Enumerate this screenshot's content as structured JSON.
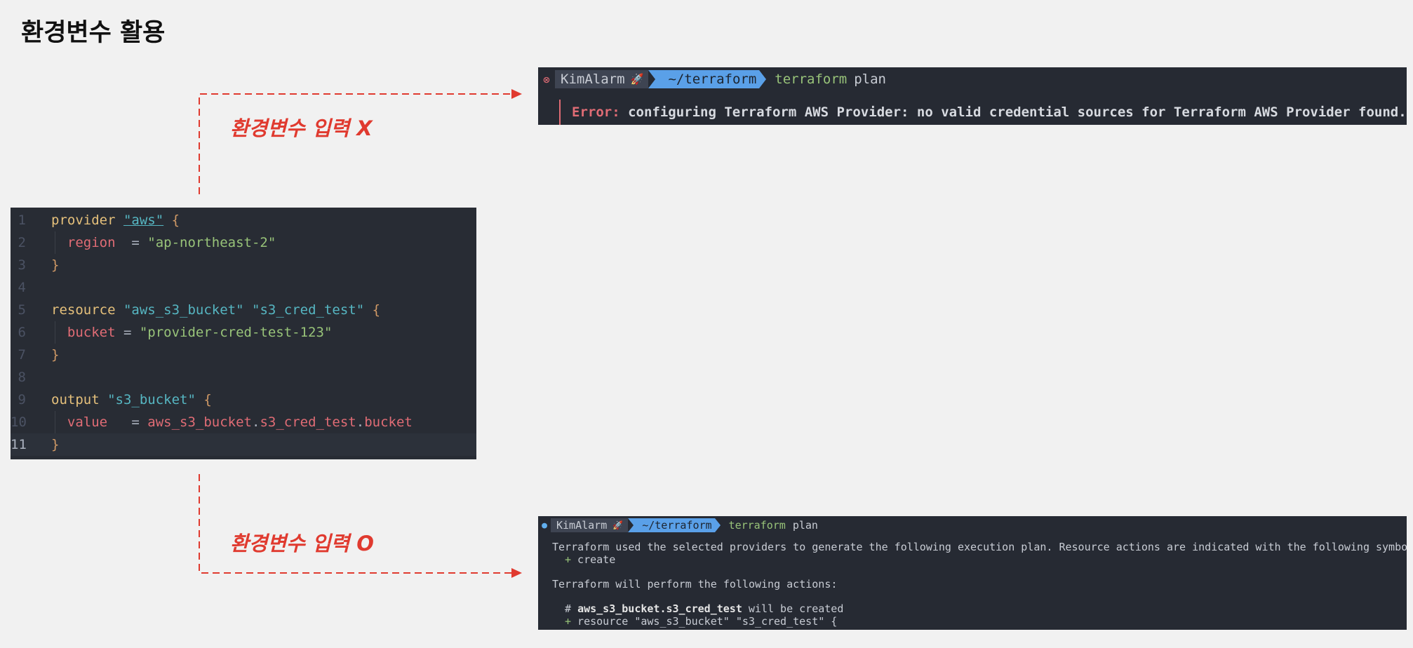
{
  "title": "환경변수 활용",
  "editor": {
    "lines": [
      {
        "n": "1",
        "parts": [
          {
            "t": "provider",
            "c": "tk-kw"
          },
          {
            "t": " ",
            "c": ""
          },
          {
            "t": "\"aws\"",
            "c": "tk-lbl tk-underline"
          },
          {
            "t": " {",
            "c": "tk-brace"
          }
        ]
      },
      {
        "n": "2",
        "parts": [
          {
            "t": "  region",
            "c": "tk-attr"
          },
          {
            "t": "  = ",
            "c": "tk-op"
          },
          {
            "t": "\"ap-northeast-2\"",
            "c": "tk-str"
          }
        ]
      },
      {
        "n": "3",
        "parts": [
          {
            "t": "}",
            "c": "tk-brace"
          }
        ]
      },
      {
        "n": "4",
        "parts": []
      },
      {
        "n": "5",
        "parts": [
          {
            "t": "resource",
            "c": "tk-kw"
          },
          {
            "t": " ",
            "c": ""
          },
          {
            "t": "\"aws_s3_bucket\"",
            "c": "tk-lbl"
          },
          {
            "t": " ",
            "c": ""
          },
          {
            "t": "\"s3_cred_test\"",
            "c": "tk-lbl"
          },
          {
            "t": " {",
            "c": "tk-brace"
          }
        ]
      },
      {
        "n": "6",
        "parts": [
          {
            "t": "  bucket",
            "c": "tk-attr"
          },
          {
            "t": " = ",
            "c": "tk-op"
          },
          {
            "t": "\"provider-cred-test-123\"",
            "c": "tk-str"
          }
        ]
      },
      {
        "n": "7",
        "parts": [
          {
            "t": "}",
            "c": "tk-brace"
          }
        ]
      },
      {
        "n": "8",
        "parts": []
      },
      {
        "n": "9",
        "parts": [
          {
            "t": "output",
            "c": "tk-kw"
          },
          {
            "t": " ",
            "c": ""
          },
          {
            "t": "\"s3_bucket\"",
            "c": "tk-lbl"
          },
          {
            "t": " {",
            "c": "tk-brace"
          }
        ]
      },
      {
        "n": "10",
        "parts": [
          {
            "t": "  value",
            "c": "tk-attr"
          },
          {
            "t": "   = ",
            "c": "tk-op"
          },
          {
            "t": "aws_s3_bucket",
            "c": "tk-ref"
          },
          {
            "t": ".",
            "c": "tk-op"
          },
          {
            "t": "s3_cred_test",
            "c": "tk-ref"
          },
          {
            "t": ".",
            "c": "tk-op"
          },
          {
            "t": "bucket",
            "c": "tk-ref"
          }
        ]
      },
      {
        "n": "11",
        "parts": [
          {
            "t": "}",
            "c": "tk-brace"
          }
        ]
      }
    ],
    "active_line": "11"
  },
  "branches": {
    "fail_label": "환경변수 입력 X",
    "ok_label": "환경변수 입력 O"
  },
  "terminal_fail": {
    "status_icon": "⊗",
    "user": "KimAlarm",
    "rocket_icon": "🚀",
    "dir": "~/terraform",
    "cmd": "terraform",
    "args": "plan",
    "error_label": "Error:",
    "error_msg": " configuring Terraform AWS Provider: no valid credential sources for Terraform AWS Provider found."
  },
  "terminal_ok": {
    "status_icon": "●",
    "user": "KimAlarm",
    "rocket_icon": "🚀",
    "dir": "~/terraform",
    "cmd": "terraform",
    "args": "plan",
    "line1": "Terraform used the selected providers to generate the following execution plan. Resource actions are indicated with the following symbols:",
    "line2_plus": "+",
    "line2_text": " create",
    "line3": "Terraform will perform the following actions:",
    "line4_hash": "# ",
    "line4_res": "aws_s3_bucket.s3_cred_test",
    "line4_rest": " will be created",
    "line5_plus": "+",
    "line5_text": " resource \"aws_s3_bucket\" \"s3_cred_test\" {"
  },
  "colors": {
    "accent_red": "#e03a2f",
    "terminal_bg": "#262a33",
    "editor_bg": "#282c34",
    "prompt_dir": "#5aa0e8"
  }
}
